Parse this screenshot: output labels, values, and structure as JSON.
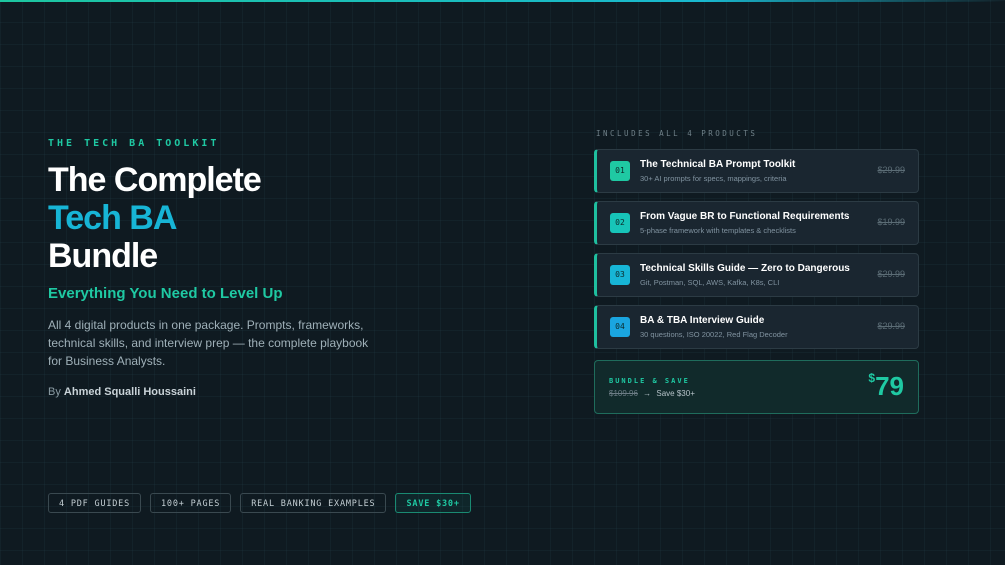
{
  "hero": {
    "eyebrow": "THE TECH BA TOOLKIT",
    "title_line1": "The Complete",
    "title_line2": "Tech BA",
    "title_line3": "Bundle",
    "subhead": "Everything You Need to Level Up",
    "description": "All 4 digital products in one package. Prompts, frameworks, technical skills, and interview prep — the complete playbook for Business Analysts.",
    "byline_prefix": "By",
    "author": "Ahmed Squalli Houssaini"
  },
  "tags": [
    "4 PDF GUIDES",
    "100+ PAGES",
    "REAL BANKING EXAMPLES",
    "SAVE $30+"
  ],
  "includes_label": "INCLUDES ALL 4 PRODUCTS",
  "products": [
    {
      "num": "01",
      "title": "The Technical BA Prompt Toolkit",
      "subtitle": "30+ AI prompts for specs, mappings, criteria",
      "price": "$29.99",
      "color": "#1fc9a3"
    },
    {
      "num": "02",
      "title": "From Vague BR to Functional Requirements",
      "subtitle": "5-phase framework with templates & checklists",
      "price": "$19.99",
      "color": "#17c4b8"
    },
    {
      "num": "03",
      "title": "Technical Skills Guide — Zero to Dangerous",
      "subtitle": "Git, Postman, SQL, AWS, Kafka, K8s, CLI",
      "price": "$29.99",
      "color": "#17b5d6"
    },
    {
      "num": "04",
      "title": "BA & TBA Interview Guide",
      "subtitle": "30 questions, ISO 20022, Red Flag Decoder",
      "price": "$29.99",
      "color": "#1aa5e0"
    }
  ],
  "bundle": {
    "label": "BUNDLE & SAVE",
    "original_price": "$109.96",
    "arrow": "→",
    "save_text": "Save $30+",
    "currency": "$",
    "price": "79"
  },
  "colors": {
    "accent_green": "#1fc9a3",
    "accent_blue": "#17b5d6",
    "background": "#0f1a21"
  }
}
